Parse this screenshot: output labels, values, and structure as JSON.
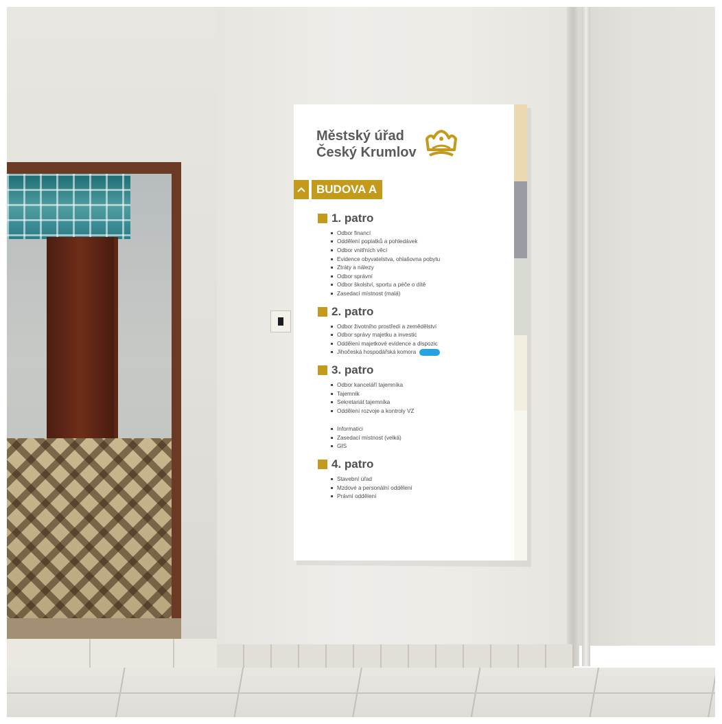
{
  "sign": {
    "title_line1": "Městský úřad",
    "title_line2": "Český Krumlov",
    "logo_icon": "crown-icon",
    "building": "BUDOVA A",
    "accent_color": "#c39a1c",
    "strip_colors": [
      "#ecd9b1",
      "#9b9ba3",
      "#d8dbd2",
      "#f3efe0",
      "#f7f6ef"
    ],
    "floors": [
      {
        "title": "1. patro",
        "items": [
          "Odbor financí",
          "Oddělení poplatků a pohledávek",
          "Odbor vnitřních věcí",
          "Evidence obyvatelstva, ohlašovna pobytu",
          "Ztráty a nálezy",
          "Odbor správní",
          "Odbor školství, sportu a péče o dítě",
          "Zasedací místnost (malá)"
        ]
      },
      {
        "title": "2. patro",
        "items": [
          "Odbor životního prostředí a zemědělství",
          "Odbor správy majetku a investic",
          "Oddělení majetkové evidence a dispozic",
          "Jihočeská hospodářská komora"
        ]
      },
      {
        "title": "3. patro",
        "items": [
          "Odbor kanceláří tajemníka",
          "Tajemník",
          "Sekretariát tajemníka",
          "Oddělení rozvoje a kontroly VZ",
          "",
          "Informatici",
          "Zasedací místnost (velká)",
          "GIS"
        ]
      },
      {
        "title": "4. patro",
        "items": [
          "Stavební úřad",
          "Mzdové a personální oddělení",
          "Právní oddělení"
        ]
      }
    ]
  }
}
